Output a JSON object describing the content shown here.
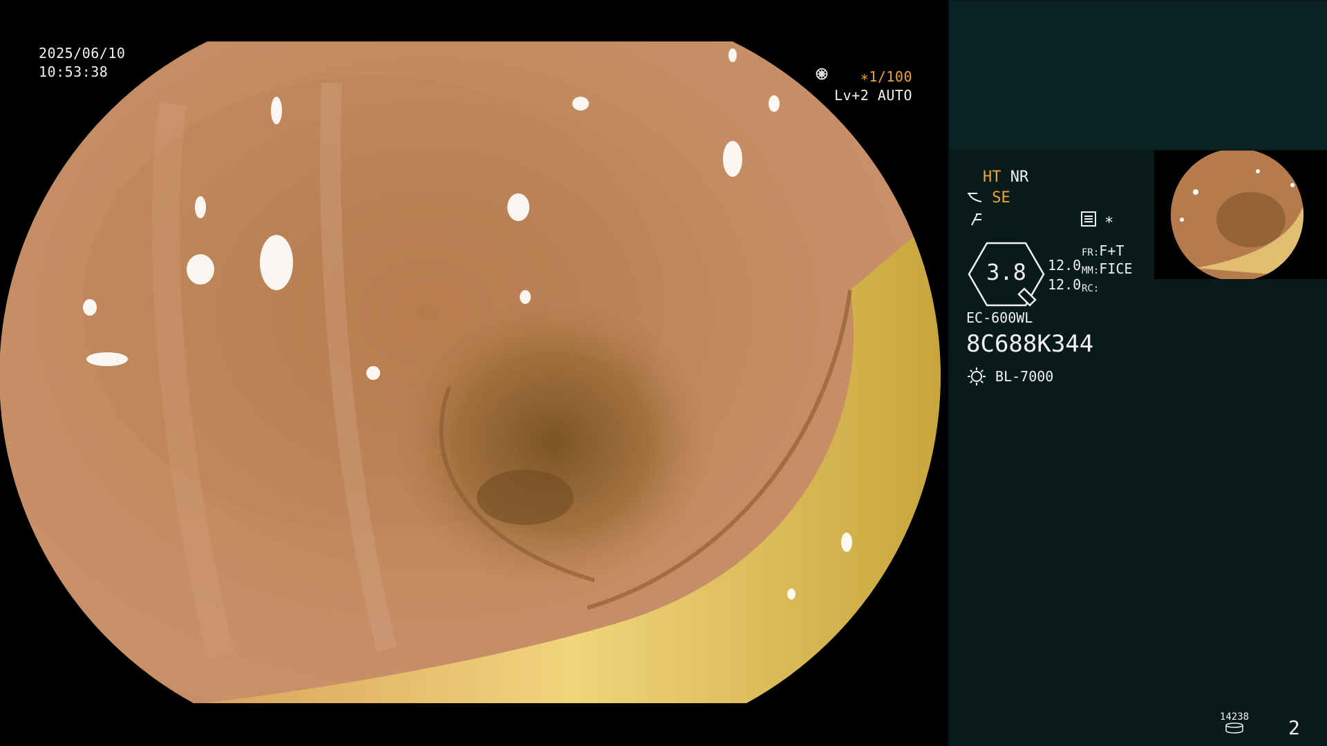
{
  "overlay": {
    "date": "2025/06/10",
    "time": "10:53:38",
    "shutter": "∗1/100",
    "level_auto": "Lv+2 AUTO"
  },
  "settings": {
    "ht": "HT",
    "nr": "NR",
    "se": "SE",
    "iris_value": "3.8",
    "val1": "12.0",
    "val2": "12.0",
    "fr_label": "FR:",
    "fr_value": "F+T",
    "mm_label": "MM:",
    "mm_value": "FICE",
    "rc_label": "RC:",
    "star": "∗"
  },
  "device": {
    "scope_model": "EC-600WL",
    "serial": "8C688K344",
    "light_source": "BL-7000"
  },
  "footer": {
    "storage_count": "14238",
    "image_count": "2"
  },
  "colors": {
    "accent": "#f0a330",
    "panel_bg": "#091a1a",
    "panel_top": "#0b2324",
    "text": "#f2f2f2"
  },
  "icons": [
    "shutter-icon",
    "auto-icon",
    "scope-icon",
    "freeze-icon",
    "menu-icon",
    "iris-hexagon-icon",
    "light-source-icon",
    "storage-icon"
  ]
}
